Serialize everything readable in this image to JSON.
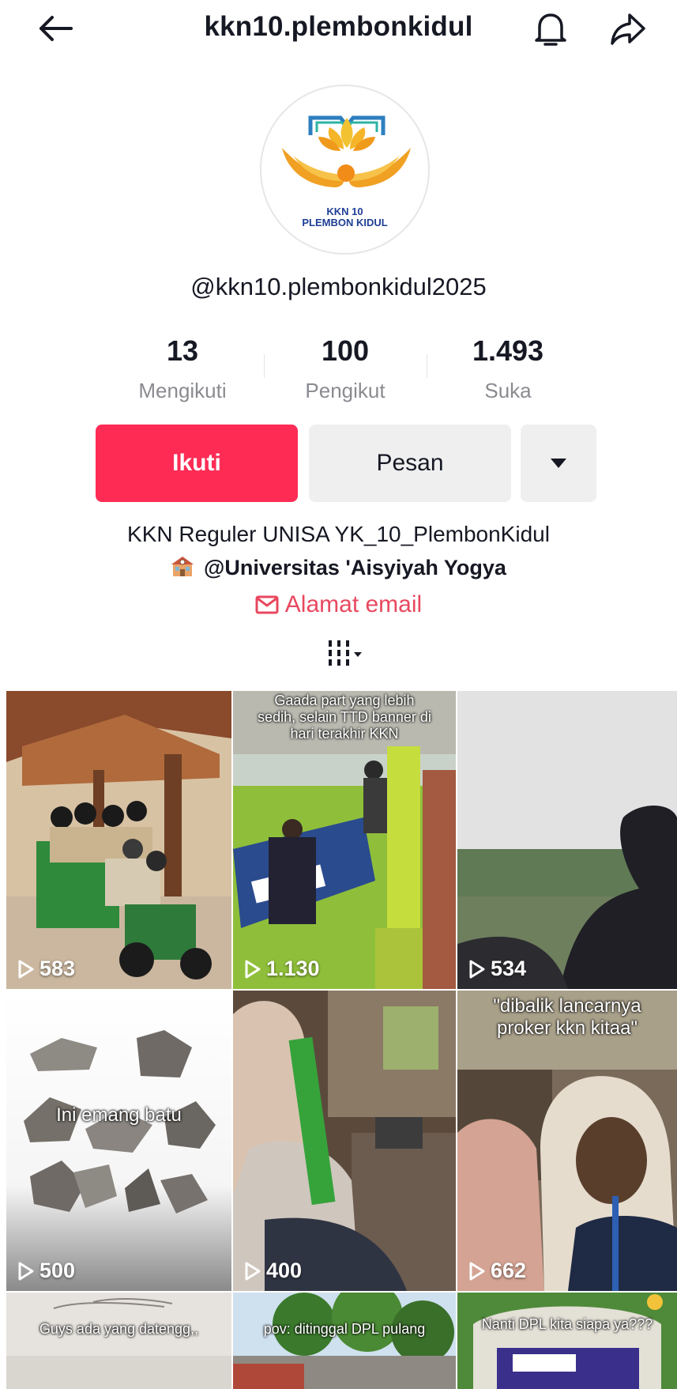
{
  "header": {
    "title": "kkn10.plembonkidul"
  },
  "avatar": {
    "line1": "KKN 10",
    "line2": "PLEMBON KIDUL"
  },
  "profile": {
    "username": "@kkn10.plembonkidul2025",
    "stats": [
      {
        "value": "13",
        "label": "Mengikuti"
      },
      {
        "value": "100",
        "label": "Pengikut"
      },
      {
        "value": "1.493",
        "label": "Suka"
      }
    ],
    "follow_label": "Ikuti",
    "message_label": "Pesan",
    "bio_line1": "KKN Reguler UNISA YK_10_PlembonKidul",
    "bio_line2": "@Universitas 'Aisyiyah Yogya",
    "email_label": "Alamat email"
  },
  "colors": {
    "accent": "#fe2c55",
    "email": "#e8485f"
  },
  "videos": [
    {
      "views": "583",
      "caption": ""
    },
    {
      "views": "1.130",
      "caption": "Gaada part yang lebih sedih, selain TTD banner di hari terakhir KKN"
    },
    {
      "views": "534",
      "caption": ""
    },
    {
      "views": "500",
      "caption": "Ini emang batu"
    },
    {
      "views": "400",
      "caption": ""
    },
    {
      "views": "662",
      "caption": "\"dibalik lancarnya proker kkn kitaa\""
    },
    {
      "views": "",
      "caption": "Guys ada yang datengg,,"
    },
    {
      "views": "",
      "caption": "pov: ditinggal DPL pulang"
    },
    {
      "views": "",
      "caption": "Nanti DPL kita siapa ya???"
    }
  ]
}
